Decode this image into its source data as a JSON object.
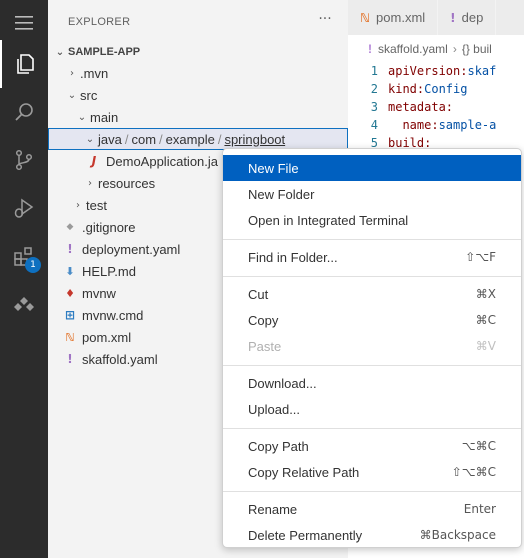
{
  "activity_bar": {
    "items": [
      {
        "icon": "files-icon",
        "active": true
      },
      {
        "icon": "search-icon"
      },
      {
        "icon": "source-control-icon"
      },
      {
        "icon": "run-debug-icon"
      },
      {
        "icon": "extensions-icon",
        "badge": "1"
      },
      {
        "icon": "cloud-code-icon"
      }
    ]
  },
  "sidebar": {
    "title": "EXPLORER",
    "more": "···",
    "section": "SAMPLE-APP",
    "tree": [
      {
        "label": ".mvn",
        "chevron": "›"
      },
      {
        "label": "src",
        "chevron": "⌄"
      },
      {
        "label": "main",
        "chevron": "⌄"
      },
      {
        "path": [
          "java",
          "com",
          "example",
          "springboot"
        ],
        "chevron": "⌄"
      },
      {
        "label": "DemoApplication.ja",
        "icon": "J",
        "icon_color": "#c5372c"
      },
      {
        "label": "resources",
        "chevron": "›"
      },
      {
        "label": "test",
        "chevron": "›"
      },
      {
        "label": ".gitignore",
        "icon": "◆",
        "icon_color": "#9a9a9a"
      },
      {
        "label": "deployment.yaml",
        "icon": "!",
        "icon_color": "#a074c4"
      },
      {
        "label": "HELP.md",
        "icon": "⬇",
        "icon_color": "#4a8cc7"
      },
      {
        "label": "mvnw",
        "icon": "♦",
        "icon_color": "#c5372c"
      },
      {
        "label": "mvnw.cmd",
        "icon": "⊞",
        "icon_color": "#2d7cc1"
      },
      {
        "label": "pom.xml",
        "icon": "ℕ",
        "icon_color": "#e37933"
      },
      {
        "label": "skaffold.yaml",
        "icon": "!",
        "icon_color": "#a074c4"
      }
    ]
  },
  "editor": {
    "tabs": [
      {
        "label": "pom.xml",
        "icon": "ℕ",
        "icon_color": "#e37933"
      },
      {
        "label": "dep",
        "icon": "!",
        "icon_color": "#a074c4"
      }
    ],
    "breadcrumb": {
      "file": "skaffold.yaml",
      "symbol": "{} buil"
    },
    "lines": [
      {
        "n": "1",
        "key": "apiVersion:",
        "val": " skaf"
      },
      {
        "n": "2",
        "key": "kind:",
        "val": " Config"
      },
      {
        "n": "3",
        "key": "metadata:",
        "val": ""
      },
      {
        "n": "4",
        "key": "  name:",
        "val": " sample-a"
      },
      {
        "n": "5",
        "key": "build:",
        "val": ""
      }
    ]
  },
  "context_menu": {
    "groups": [
      [
        {
          "label": "New File",
          "active": true
        },
        {
          "label": "New Folder"
        },
        {
          "label": "Open in Integrated Terminal"
        }
      ],
      [
        {
          "label": "Find in Folder...",
          "shortcut": "⇧⌥F"
        }
      ],
      [
        {
          "label": "Cut",
          "shortcut": "⌘X"
        },
        {
          "label": "Copy",
          "shortcut": "⌘C"
        },
        {
          "label": "Paste",
          "shortcut": "⌘V",
          "disabled": true
        }
      ],
      [
        {
          "label": "Download..."
        },
        {
          "label": "Upload..."
        }
      ],
      [
        {
          "label": "Copy Path",
          "shortcut": "⌥⌘C"
        },
        {
          "label": "Copy Relative Path",
          "shortcut": "⇧⌥⌘C"
        }
      ],
      [
        {
          "label": "Rename",
          "shortcut": "Enter"
        },
        {
          "label": "Delete Permanently",
          "shortcut": "⌘Backspace"
        }
      ]
    ]
  }
}
